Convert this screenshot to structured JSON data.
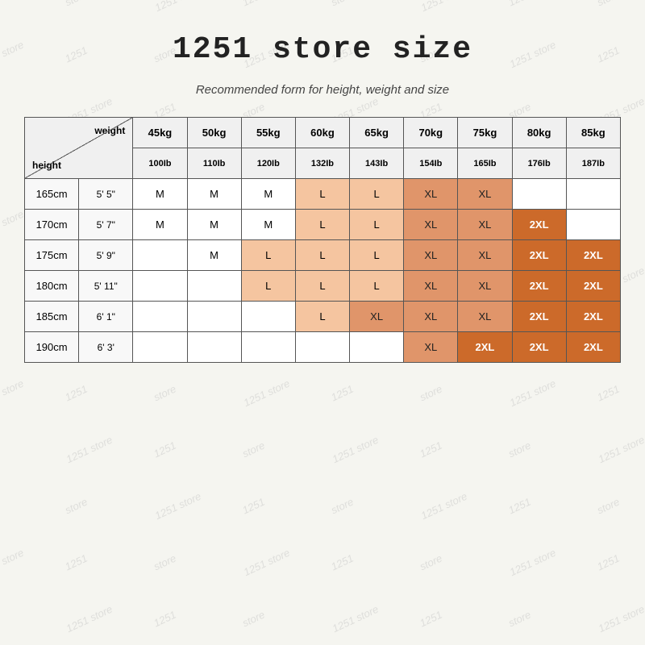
{
  "title": "1251 store size",
  "subtitle": "Recommended form for height, weight and size",
  "watermark_text": "1251 store",
  "table": {
    "corner_weight": "weight",
    "corner_height": "height",
    "kg_headers": [
      "45kg",
      "50kg",
      "55kg",
      "60kg",
      "65kg",
      "70kg",
      "75kg",
      "80kg",
      "85kg"
    ],
    "lb_headers": [
      "100Ib",
      "110Ib",
      "120Ib",
      "132Ib",
      "143Ib",
      "154Ib",
      "165Ib",
      "176Ib",
      "187Ib"
    ],
    "rows": [
      {
        "cm": "165cm",
        "ft": "5' 5\"",
        "cells": [
          "M",
          "M",
          "M",
          "L",
          "L",
          "XL",
          "XL",
          "",
          ""
        ]
      },
      {
        "cm": "170cm",
        "ft": "5' 7\"",
        "cells": [
          "M",
          "M",
          "M",
          "L",
          "L",
          "XL",
          "XL",
          "2XL",
          ""
        ]
      },
      {
        "cm": "175cm",
        "ft": "5' 9\"",
        "cells": [
          "",
          "M",
          "L",
          "L",
          "L",
          "XL",
          "XL",
          "2XL",
          "2XL"
        ]
      },
      {
        "cm": "180cm",
        "ft": "5' 11\"",
        "cells": [
          "",
          "",
          "L",
          "L",
          "L",
          "XL",
          "XL",
          "2XL",
          "2XL"
        ]
      },
      {
        "cm": "185cm",
        "ft": "6' 1\"",
        "cells": [
          "",
          "",
          "",
          "L",
          "XL",
          "XL",
          "XL",
          "2XL",
          "2XL"
        ]
      },
      {
        "cm": "190cm",
        "ft": "6' 3'",
        "cells": [
          "",
          "",
          "",
          "",
          "",
          "XL",
          "2XL",
          "2XL",
          "2XL"
        ]
      }
    ]
  }
}
